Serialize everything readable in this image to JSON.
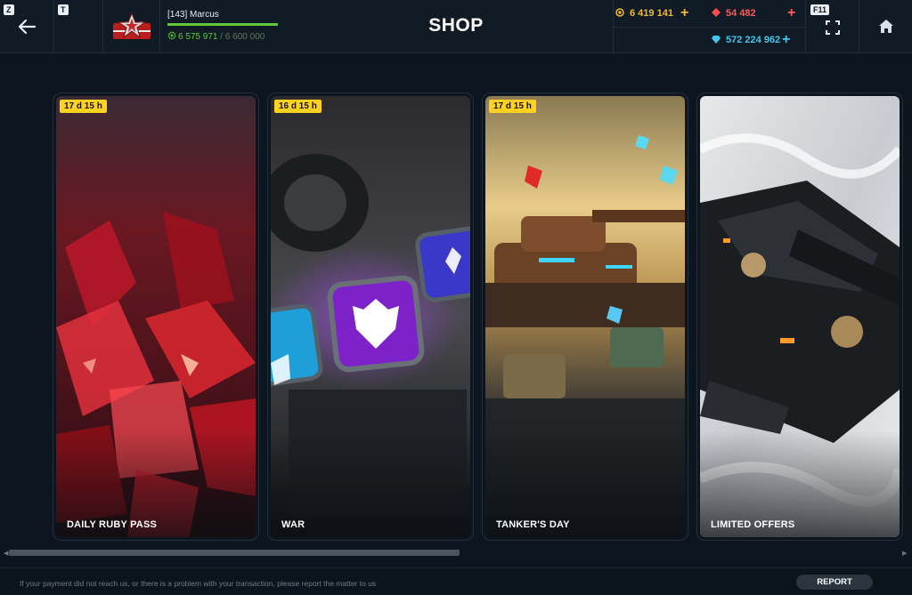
{
  "hotkeys": {
    "back": "Z",
    "friends": "T",
    "fullscreen": "F11"
  },
  "profile": {
    "username": "[143] Marcus",
    "experience": "6 575 971",
    "experience_separator": " / ",
    "experience_next": "6 600 000",
    "experience_progress": 0.996
  },
  "header": {
    "title": "SHOP"
  },
  "currencies": {
    "crystals_gold": {
      "value": "6 419 141",
      "color": "#f5b82e"
    },
    "rubies": {
      "value": "54 482",
      "color": "#ff5a5a"
    },
    "diamonds": {
      "value": "572 224 962",
      "color": "#43c6f0"
    }
  },
  "icons": [
    "back-arrow-icon",
    "friends-icon",
    "rank-emblem-icon",
    "gear-icon",
    "coin-icon",
    "ruby-icon",
    "diamond-icon",
    "plus-icon",
    "fullscreen-icon",
    "home-icon"
  ],
  "cards": [
    {
      "label": "DAILY RUBY PASS",
      "timer": "17 d 15 h"
    },
    {
      "label": "WAR",
      "timer": "16 d 15 h"
    },
    {
      "label": "TANKER'S DAY",
      "timer": "17 d 15 h"
    },
    {
      "label": "LIMITED OFFERS",
      "timer": ""
    }
  ],
  "footer": {
    "notice": "If your payment did not reach us, or there is a problem with your transaction, please report the matter to us",
    "report_label": "REPORT"
  }
}
